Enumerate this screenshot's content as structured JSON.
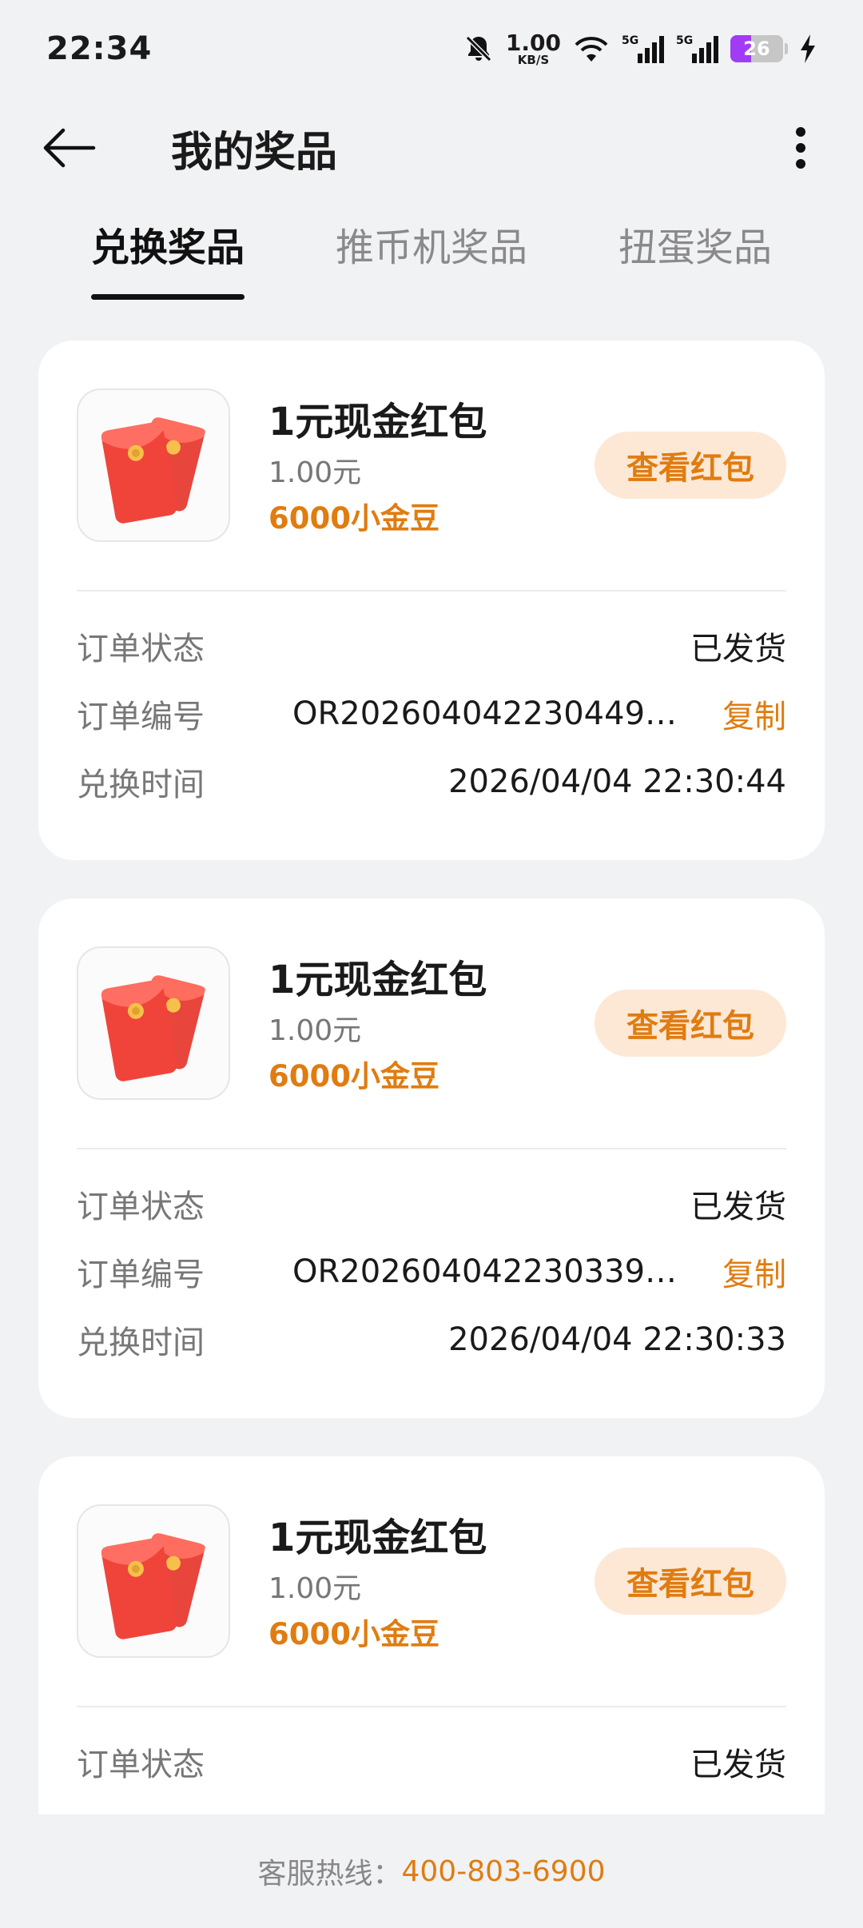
{
  "status_bar": {
    "time": "22:34",
    "speed_value": "1.00",
    "speed_unit": "KB/S",
    "network_1": "5G",
    "network_2": "5G",
    "battery": "26",
    "icons": [
      "mute-bell-icon",
      "wifi-icon",
      "signal-icon",
      "signal-icon",
      "battery-icon",
      "charging-icon"
    ]
  },
  "header": {
    "title": "我的奖品",
    "back_icon": "back-arrow-icon",
    "more_icon": "more-vertical-icon"
  },
  "tabs": [
    {
      "label": "兑换奖品",
      "active": true
    },
    {
      "label": "推币机奖品",
      "active": false
    },
    {
      "label": "扭蛋奖品",
      "active": false
    }
  ],
  "orders": [
    {
      "name": "1元现金红包",
      "price": "1.00元",
      "cost": "6000小金豆",
      "button": "查看红包",
      "status_label": "订单状态",
      "status": "已发货",
      "order_label": "订单编号",
      "order_no": "OR2026040422304490...",
      "copy": "复制",
      "time_label": "兑换时间",
      "time": "2026/04/04 22:30:44"
    },
    {
      "name": "1元现金红包",
      "price": "1.00元",
      "cost": "6000小金豆",
      "button": "查看红包",
      "status_label": "订单状态",
      "status": "已发货",
      "order_label": "订单编号",
      "order_no": "OR2026040422303390...",
      "copy": "复制",
      "time_label": "兑换时间",
      "time": "2026/04/04 22:30:33"
    },
    {
      "name": "1元现金红包",
      "price": "1.00元",
      "cost": "6000小金豆",
      "button": "查看红包",
      "status_label": "订单状态",
      "status": "已发货"
    }
  ],
  "footer": {
    "hotline_label": "客服热线：",
    "hotline": "400-803-6900"
  },
  "colors": {
    "accent": "#e07c10",
    "button_bg": "#fde8d6",
    "page_bg": "#f1f2f4",
    "battery_purple": "#a23bf6"
  }
}
